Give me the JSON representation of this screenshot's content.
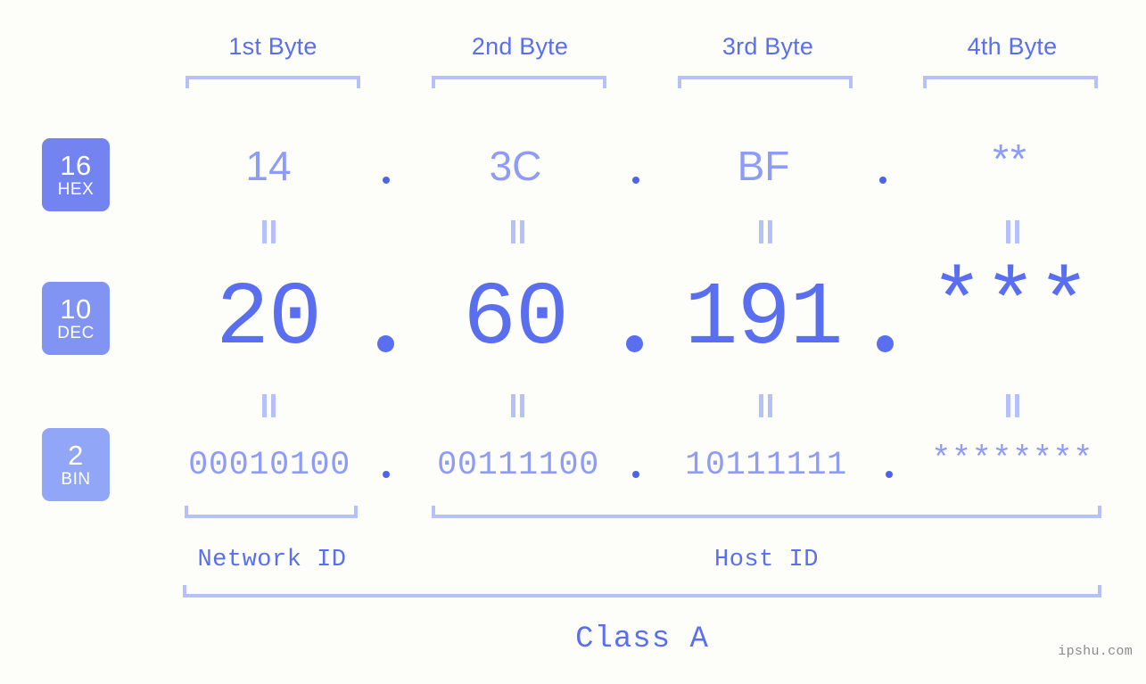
{
  "page": {
    "background_color": "#fdfefa",
    "accent_color": "#5a6ef0",
    "light_accent_color": "#8f9cf7",
    "bracket_color": "#b6c0fb",
    "watermark": "ipshu.com"
  },
  "byte_headers": [
    {
      "label": "1st Byte"
    },
    {
      "label": "2nd Byte"
    },
    {
      "label": "3rd Byte"
    },
    {
      "label": "4th Byte"
    }
  ],
  "bases": [
    {
      "number": "16",
      "name": "HEX",
      "color": "#7384f0"
    },
    {
      "number": "10",
      "name": "DEC",
      "color": "#8193f3"
    },
    {
      "number": "2",
      "name": "BIN",
      "color": "#92a6f7"
    }
  ],
  "rows": {
    "hex": {
      "base_number": "16",
      "base_name": "HEX",
      "values": [
        "14",
        "3C",
        "BF",
        "**"
      ],
      "separator": "."
    },
    "dec": {
      "base_number": "10",
      "base_name": "DEC",
      "values": [
        "20",
        "60",
        "191",
        "***"
      ],
      "separator": "."
    },
    "bin": {
      "base_number": "2",
      "base_name": "BIN",
      "values": [
        "00010100",
        "00111100",
        "10111111",
        "********"
      ],
      "separator": "."
    }
  },
  "equality_marks": {
    "glyph": "=",
    "count_per_row": 4
  },
  "id_labels": {
    "network": "Network ID",
    "host": "Host ID"
  },
  "class_label": "Class A"
}
